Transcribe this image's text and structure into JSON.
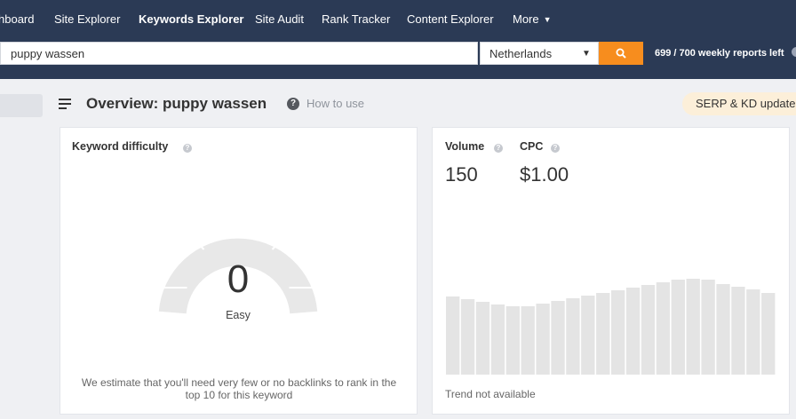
{
  "nav": {
    "items": [
      {
        "label": "hboard",
        "active": false
      },
      {
        "label": "Site Explorer",
        "active": false
      },
      {
        "label": "Keywords Explorer",
        "active": true
      },
      {
        "label": "Site Audit",
        "active": false
      },
      {
        "label": "Rank Tracker",
        "active": false
      },
      {
        "label": "Content Explorer",
        "active": false
      },
      {
        "label": "More",
        "active": false
      }
    ]
  },
  "search": {
    "query": "puppy wassen",
    "country": "Netherlands",
    "reports_left": "699 / 700 weekly reports left"
  },
  "overview": {
    "title": "Overview: puppy wassen",
    "how_to_use": "How to use",
    "serp_badge": "SERP & KD update"
  },
  "keyword_difficulty": {
    "label": "Keyword difficulty",
    "value": "0",
    "level": "Easy",
    "description": "We estimate that you'll need very few or no backlinks to rank in the top 10 for this keyword"
  },
  "volume": {
    "label": "Volume",
    "value": "150"
  },
  "cpc": {
    "label": "CPC",
    "value": "$1.00"
  },
  "trend": {
    "note": "Trend not available",
    "bar_color": "#e4e4e4",
    "values": [
      88,
      85,
      82,
      79,
      77,
      77,
      80,
      83,
      86,
      89,
      92,
      95,
      98,
      101,
      104,
      107,
      108,
      107,
      102,
      99,
      96,
      92
    ]
  },
  "colors": {
    "nav_bg": "#2b3a55",
    "search_button": "#f78d1e",
    "gauge_track": "#e8e8e8",
    "badge_bg": "#fcefd9"
  }
}
